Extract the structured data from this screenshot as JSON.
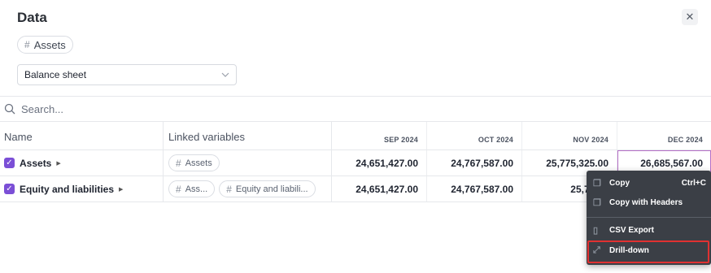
{
  "dialog": {
    "title": "Data",
    "close_glyph": "✕",
    "tag": {
      "icon": "hash-icon",
      "label": "Assets"
    }
  },
  "view_select": {
    "value": "Balance sheet"
  },
  "search": {
    "placeholder": "Search..."
  },
  "table": {
    "headers": {
      "name": "Name",
      "linked": "Linked variables",
      "months": [
        "SEP 2024",
        "OCT 2024",
        "NOV 2024",
        "DEC 2024"
      ]
    },
    "rows": [
      {
        "name": "Assets",
        "checked": true,
        "linked": [
          "Assets"
        ],
        "values": [
          "24,651,427.00",
          "24,767,587.00",
          "25,775,325.00",
          "26,685,567.00"
        ]
      },
      {
        "name": "Equity and liabilities",
        "checked": true,
        "linked": [
          "Ass...",
          "Equity and liabili..."
        ],
        "values": [
          "24,651,427.00",
          "24,767,587.00",
          "25,775,3",
          ""
        ]
      }
    ]
  },
  "context_menu": {
    "items": [
      {
        "label": "Copy",
        "shortcut": "Ctrl+C",
        "icon": "copy-icon"
      },
      {
        "label": "Copy with Headers",
        "shortcut": "",
        "icon": "copy-icon"
      },
      {
        "label": "CSV Export",
        "shortcut": "",
        "icon": "file-icon"
      },
      {
        "label": "Drill-down",
        "shortcut": "",
        "icon": "expand-icon"
      }
    ],
    "highlighted_item": "Drill-down",
    "highlight_color": "#e03131"
  },
  "colors": {
    "checkbox": "#7b4fd6",
    "menu_bg": "#3b3f46",
    "selected_cell_border": "#b56fc6"
  }
}
